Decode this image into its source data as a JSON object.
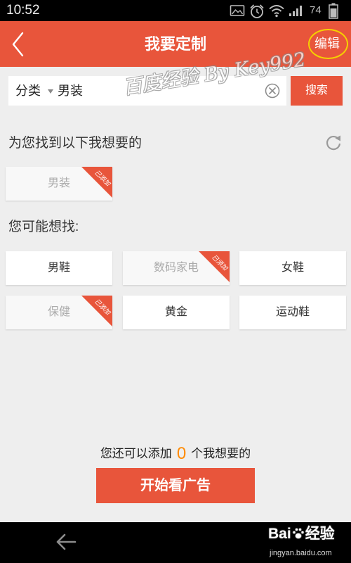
{
  "status_bar": {
    "time": "10:52",
    "battery_level": "74",
    "icons": [
      "image-icon",
      "alarm-icon",
      "wifi-icon",
      "signal-icon",
      "battery-icon"
    ]
  },
  "header": {
    "back_icon": "chevron-left-icon",
    "title": "我要定制",
    "edit_label": "编辑",
    "edit_highlighted": true
  },
  "watermark": {
    "text": "百度经验 By Key992"
  },
  "search": {
    "category_label": "分类",
    "category_caret_icon": "caret-down-icon",
    "category_value": "男装",
    "clear_icon": "clear-circle-icon",
    "button_label": "搜索"
  },
  "found_section": {
    "heading": "为您找到以下我想要的",
    "refresh_icon": "refresh-icon",
    "items": [
      {
        "label": "男装",
        "added": true,
        "badge": "已添加"
      }
    ]
  },
  "suggest_section": {
    "heading": "您可能想找:",
    "items": [
      {
        "label": "男鞋",
        "added": false
      },
      {
        "label": "数码家电",
        "added": true,
        "badge": "已添加"
      },
      {
        "label": "女鞋",
        "added": false
      },
      {
        "label": "保健",
        "added": true,
        "badge": "已添加"
      },
      {
        "label": "黄金",
        "added": false
      },
      {
        "label": "运动鞋",
        "added": false
      }
    ]
  },
  "footer": {
    "remaining_prefix": "您还可以添加",
    "remaining_count": "0",
    "remaining_suffix": "个我想要的",
    "start_button_label": "开始看广告"
  },
  "nav_bar": {
    "back_icon": "arrow-left-icon"
  },
  "baidu_logo": {
    "brand_prefix": "Bai",
    "paw_icon": "paw-icon",
    "brand_suffix": "经验",
    "url": "jingyan.baidu.com"
  },
  "colors": {
    "accent": "#e8553b",
    "count": "#ff8a00",
    "ring": "#f5d000"
  }
}
